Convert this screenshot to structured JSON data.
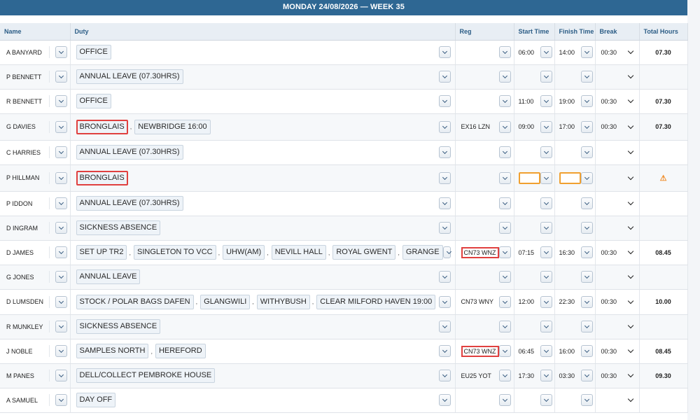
{
  "header": {
    "title": "MONDAY 24/08/2026 — WEEK 35"
  },
  "columns": {
    "name": "Name",
    "duty": "Duty",
    "reg": "Reg",
    "start": "Start Time",
    "finish": "Finish Time",
    "break": "Break",
    "total": "Total Hours"
  },
  "colors": {
    "header_bar": "#2e6793",
    "highlight_red": "#e0403f",
    "highlight_orange": "#f0a030"
  },
  "rows": [
    {
      "name": "A BANYARD",
      "duties": [
        {
          "label": "OFFICE",
          "flag": false
        }
      ],
      "reg": "",
      "reg_flag": false,
      "start": "06:00",
      "finish": "14:00",
      "break": "00:30",
      "total": "07.30",
      "time_flag": false,
      "warn": ""
    },
    {
      "name": "P BENNETT",
      "duties": [
        {
          "label": "ANNUAL LEAVE (07.30HRS)",
          "flag": false
        }
      ],
      "reg": "",
      "reg_flag": false,
      "start": "",
      "finish": "",
      "break": "",
      "total": "",
      "time_flag": false,
      "warn": ""
    },
    {
      "name": "R BENNETT",
      "duties": [
        {
          "label": "OFFICE",
          "flag": false
        }
      ],
      "reg": "",
      "reg_flag": false,
      "start": "11:00",
      "finish": "19:00",
      "break": "00:30",
      "total": "07.30",
      "time_flag": false,
      "warn": ""
    },
    {
      "name": "G DAVIES",
      "duties": [
        {
          "label": "BRONGLAIS",
          "flag": true
        },
        {
          "label": "NEWBRIDGE 16:00",
          "flag": false
        }
      ],
      "reg": "EX16 LZN",
      "reg_flag": false,
      "start": "09:00",
      "finish": "17:00",
      "break": "00:30",
      "total": "07.30",
      "time_flag": false,
      "warn": ""
    },
    {
      "name": "C HARRIES",
      "duties": [
        {
          "label": "ANNUAL LEAVE (07.30HRS)",
          "flag": false
        }
      ],
      "reg": "",
      "reg_flag": false,
      "start": "",
      "finish": "",
      "break": "",
      "total": "",
      "time_flag": false,
      "warn": ""
    },
    {
      "name": "P HILLMAN",
      "duties": [
        {
          "label": "BRONGLAIS",
          "flag": true
        }
      ],
      "reg": "",
      "reg_flag": false,
      "start": "",
      "finish": "",
      "break": "",
      "total": "",
      "time_flag": true,
      "warn": "⚠"
    },
    {
      "name": "P IDDON",
      "duties": [
        {
          "label": "ANNUAL LEAVE (07.30HRS)",
          "flag": false
        }
      ],
      "reg": "",
      "reg_flag": false,
      "start": "",
      "finish": "",
      "break": "",
      "total": "",
      "time_flag": false,
      "warn": ""
    },
    {
      "name": "D INGRAM",
      "duties": [
        {
          "label": "SICKNESS ABSENCE",
          "flag": false
        }
      ],
      "reg": "",
      "reg_flag": false,
      "start": "",
      "finish": "",
      "break": "",
      "total": "",
      "time_flag": false,
      "warn": ""
    },
    {
      "name": "D JAMES",
      "duties": [
        {
          "label": "SET UP TR2",
          "flag": false
        },
        {
          "label": "SINGLETON TO VCC",
          "flag": false
        },
        {
          "label": "UHW(AM)",
          "flag": false
        },
        {
          "label": "NEVILL HALL",
          "flag": false
        },
        {
          "label": "ROYAL GWENT",
          "flag": false
        },
        {
          "label": "GRANGE",
          "flag": false
        }
      ],
      "reg": "CN73 WNZ",
      "reg_flag": true,
      "start": "07:15",
      "finish": "16:30",
      "break": "00:30",
      "total": "08.45",
      "time_flag": false,
      "warn": ""
    },
    {
      "name": "G JONES",
      "duties": [
        {
          "label": "ANNUAL LEAVE",
          "flag": false
        }
      ],
      "reg": "",
      "reg_flag": false,
      "start": "",
      "finish": "",
      "break": "",
      "total": "",
      "time_flag": false,
      "warn": ""
    },
    {
      "name": "D LUMSDEN",
      "duties": [
        {
          "label": "STOCK / POLAR BAGS DAFEN",
          "flag": false
        },
        {
          "label": "GLANGWILI",
          "flag": false
        },
        {
          "label": "WITHYBUSH",
          "flag": false
        },
        {
          "label": "CLEAR MILFORD HAVEN 19:00",
          "flag": false
        }
      ],
      "reg": "CN73 WNY",
      "reg_flag": false,
      "start": "12:00",
      "finish": "22:30",
      "break": "00:30",
      "total": "10.00",
      "time_flag": false,
      "warn": ""
    },
    {
      "name": "R MUNKLEY",
      "duties": [
        {
          "label": "SICKNESS ABSENCE",
          "flag": false
        }
      ],
      "reg": "",
      "reg_flag": false,
      "start": "",
      "finish": "",
      "break": "",
      "total": "",
      "time_flag": false,
      "warn": ""
    },
    {
      "name": "J NOBLE",
      "duties": [
        {
          "label": "SAMPLES NORTH",
          "flag": false
        },
        {
          "label": "HEREFORD",
          "flag": false
        }
      ],
      "reg": "CN73 WNZ",
      "reg_flag": true,
      "start": "06:45",
      "finish": "16:00",
      "break": "00:30",
      "total": "08.45",
      "time_flag": false,
      "warn": ""
    },
    {
      "name": "M PANES",
      "duties": [
        {
          "label": "DELL/COLLECT PEMBROKE HOUSE",
          "flag": false
        }
      ],
      "reg": "EU25 YOT",
      "reg_flag": false,
      "start": "17:30",
      "finish": "03:30",
      "break": "00:30",
      "total": "09.30",
      "time_flag": false,
      "warn": ""
    },
    {
      "name": "A SAMUEL",
      "duties": [
        {
          "label": "DAY OFF",
          "flag": false
        }
      ],
      "reg": "",
      "reg_flag": false,
      "start": "",
      "finish": "",
      "break": "",
      "total": "",
      "time_flag": false,
      "warn": ""
    }
  ]
}
